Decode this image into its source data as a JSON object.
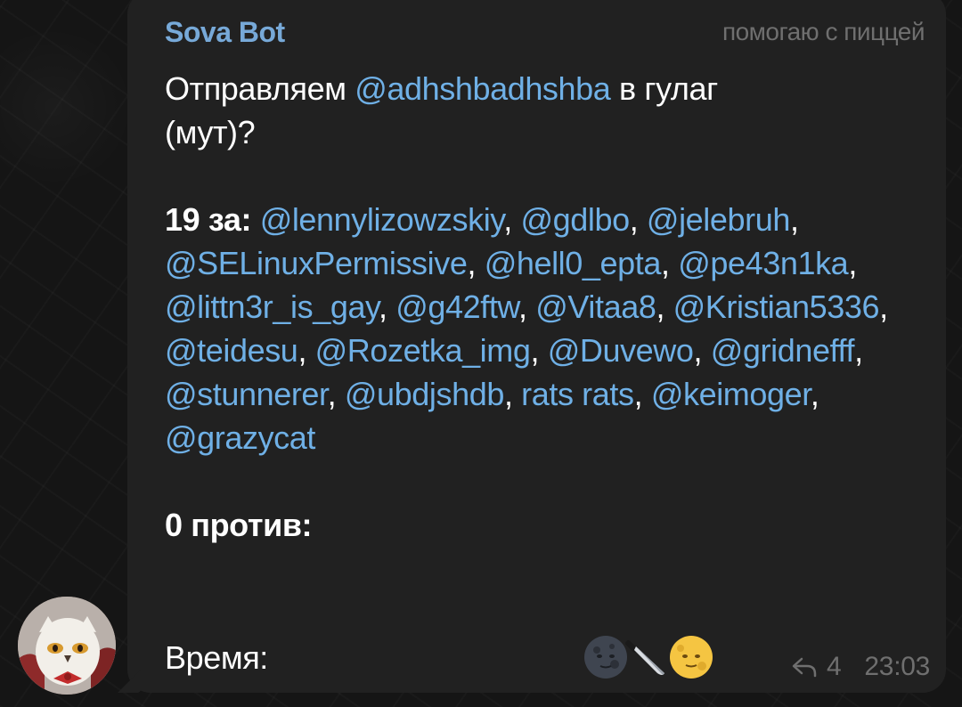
{
  "message": {
    "sender": "Sova Bot",
    "admin_title": "помогаю с пиццей",
    "intro_prefix": "Отправляем",
    "target_mention": "@adhshbadhshba",
    "intro_suffix": "в гулаг",
    "intro_line2": "(мут)?",
    "votes_for_label": "19 за:",
    "voters": [
      "@lennylizowzskiy",
      "@gdlbo",
      "@jelebruh",
      "@SELinuxPermissive",
      "@hell0_epta",
      "@pe43n1ka",
      "@littn3r_is_gay",
      "@g42ftw",
      "@Vitaa8",
      "@Kristian5336",
      "@teidesu",
      "@Rozetka_img",
      "@Duvewo",
      "@gridnefff",
      "@stunnerer",
      "@ubdjshdb",
      "rats rats",
      "@keimoger",
      "@grazycat"
    ],
    "votes_against_label": "0 против:",
    "time_label": "Время:",
    "reactions": [
      "new-moon-face",
      "kitchen-knife",
      "full-moon-face"
    ],
    "reply_count": "4",
    "timestamp": "23:03"
  }
}
